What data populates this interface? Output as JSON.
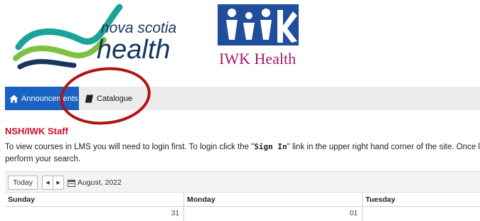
{
  "logos": {
    "nova_scotia_text": "nova scotia",
    "health_text": "health",
    "iwk_text": "IWK Health"
  },
  "nav": {
    "items": [
      {
        "label": "Announcements",
        "icon": "home-icon"
      },
      {
        "label": "Catalogue",
        "icon": "book-icon"
      }
    ]
  },
  "heading": "NSH/IWK Staff",
  "intro": {
    "part1": "To view courses in LMS you will need to login first. To login click the \"",
    "bold": "Sign In",
    "part2": "\" link in the upper right hand corner of the site. Once lo",
    "line2": "perform your search."
  },
  "calendar": {
    "today_label": "Today",
    "prev_label": "◂",
    "next_label": "▸",
    "date_label": "August, 2022",
    "days": [
      "Sunday",
      "Monday",
      "Tuesday"
    ],
    "dates": [
      "31",
      "01",
      ""
    ]
  },
  "colors": {
    "nav_active": "#1a63c4",
    "heading": "#c8102e",
    "annotation_circle": "#b01316",
    "ns_teal": "#1aa39a",
    "ns_green": "#7cc242",
    "ns_navy": "#17365d",
    "iwk_blue": "#1f4e9c",
    "iwk_magenta": "#a3196b"
  }
}
